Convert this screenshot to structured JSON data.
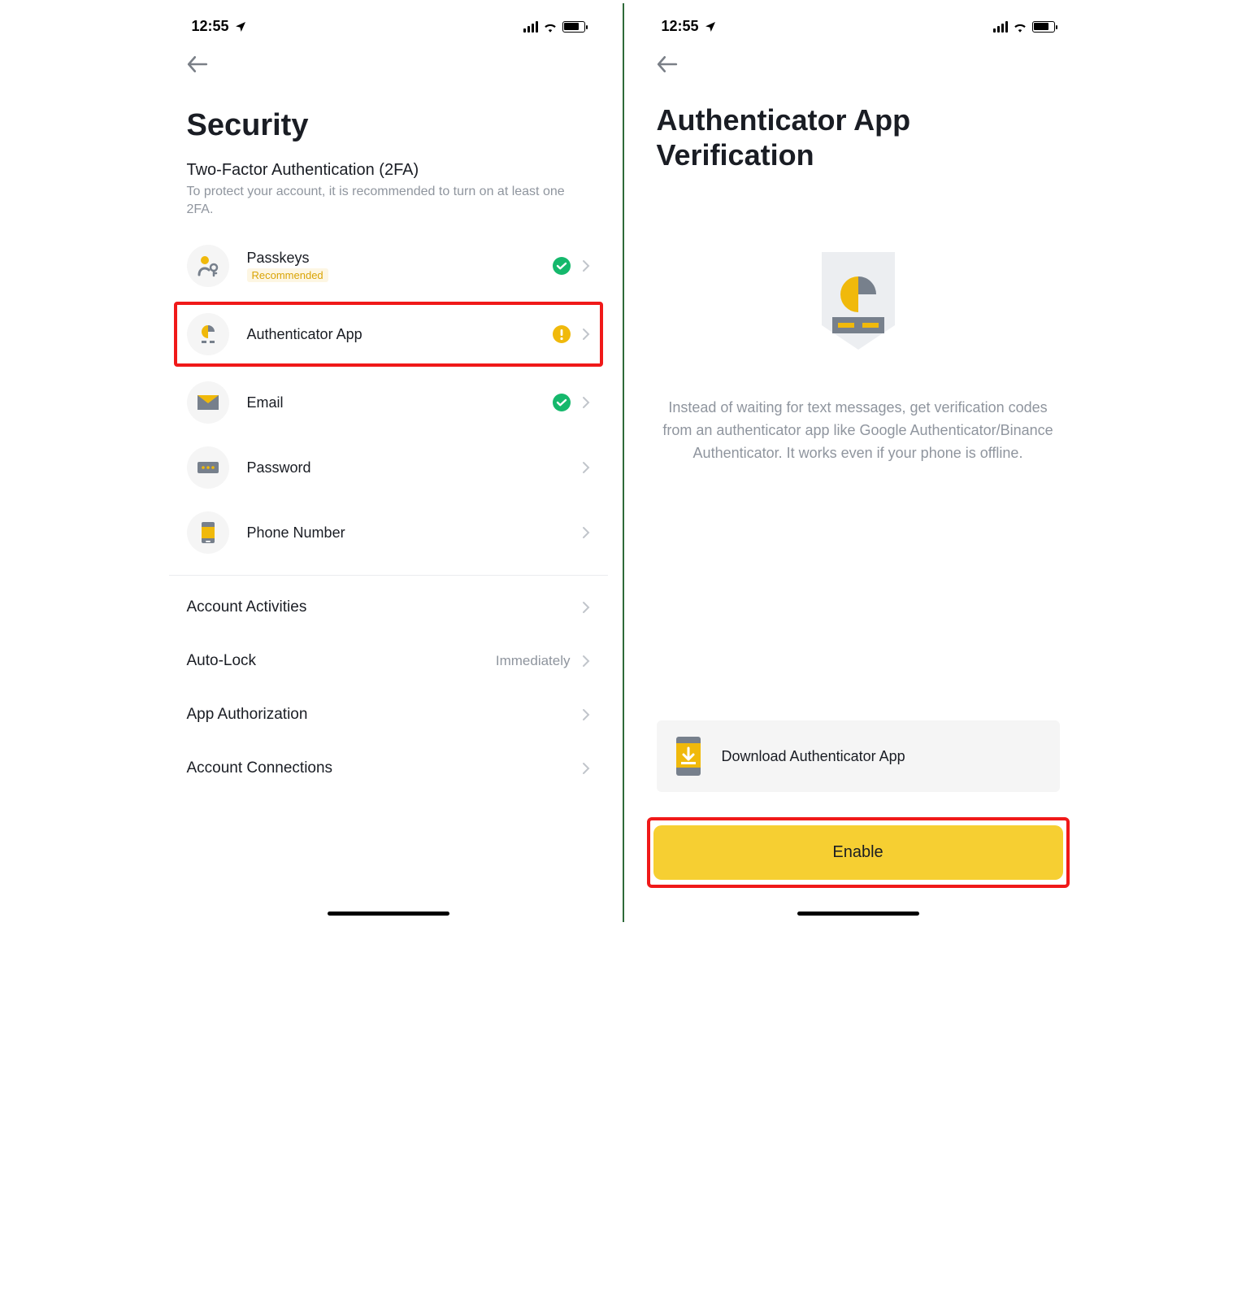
{
  "status": {
    "time": "12:55"
  },
  "left": {
    "title": "Security",
    "section_label": "Two-Factor Authentication (2FA)",
    "section_desc": "To protect your account, it is recommended to turn on at least one 2FA.",
    "items": [
      {
        "label": "Passkeys",
        "badge": "Recommended"
      },
      {
        "label": "Authenticator App"
      },
      {
        "label": "Email"
      },
      {
        "label": "Password"
      },
      {
        "label": "Phone Number"
      }
    ],
    "rows": [
      {
        "label": "Account Activities"
      },
      {
        "label": "Auto-Lock",
        "value": "Immediately"
      },
      {
        "label": "App Authorization"
      },
      {
        "label": "Account Connections"
      }
    ]
  },
  "right": {
    "title": "Authenticator App Verification",
    "desc": "Instead of waiting for text messages, get verification codes from an authenticator app like Google Authenticator/Binance Authenticator. It works even if your phone is offline.",
    "download_label": "Download Authenticator App",
    "enable_label": "Enable"
  }
}
